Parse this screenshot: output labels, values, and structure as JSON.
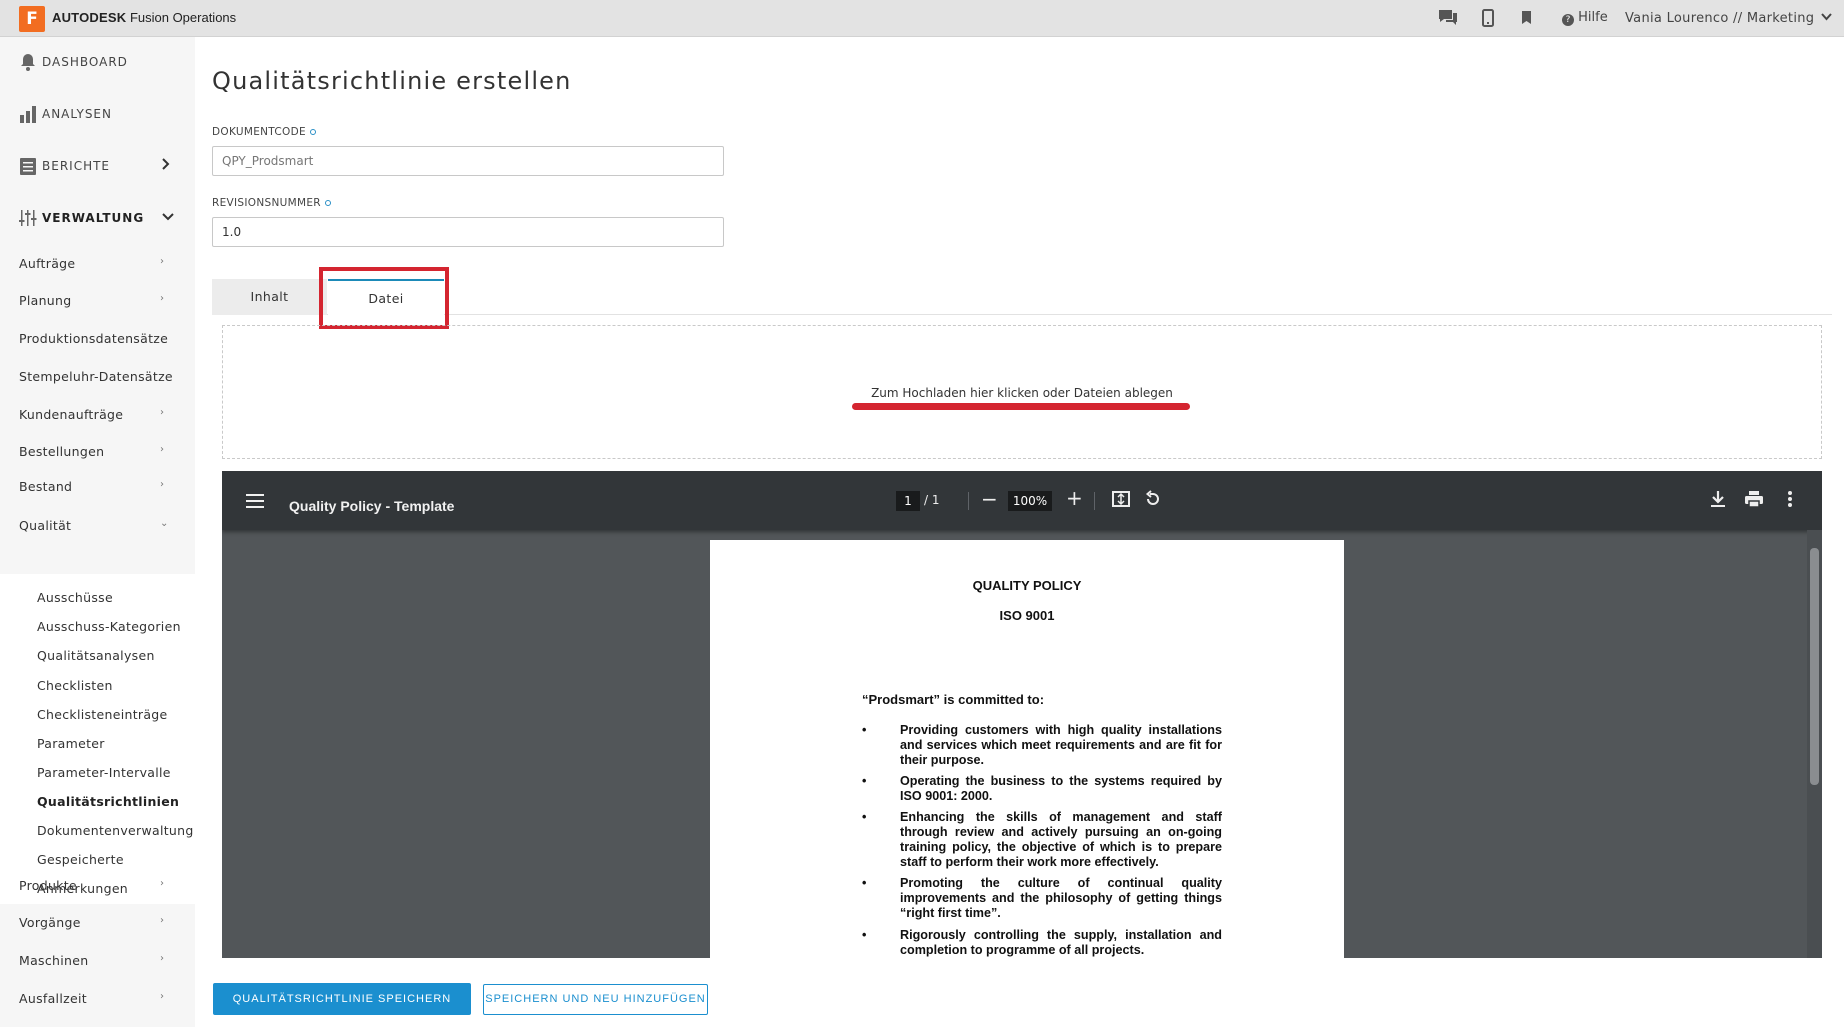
{
  "app": {
    "logo_letter": "F",
    "brand_bold": "AUTODESK",
    "brand_rest": "Fusion Operations",
    "brand_color": "#f26d21",
    "help_label": "Hilfe",
    "user_label": "Vania Lourenco // Marketing",
    "icons": [
      "chat-icon",
      "mobile-icon",
      "bookmark-icon",
      "question-icon",
      "chevron-down-icon"
    ]
  },
  "sidebar": {
    "main": [
      {
        "label": "DASHBOARD",
        "icon": "bell-icon"
      },
      {
        "label": "ANALYSEN",
        "icon": "bar-chart-icon"
      },
      {
        "label": "BERICHTE",
        "icon": "document-icon"
      },
      {
        "label": "VERWALTUNG",
        "icon": "sliders-icon"
      }
    ],
    "items": [
      {
        "label": "Aufträge"
      },
      {
        "label": "Planung"
      },
      {
        "label": "Produktionsdatensätze"
      },
      {
        "label": "Stempeluhr-Datensätze"
      },
      {
        "label": "Kundenaufträge"
      },
      {
        "label": "Bestellungen"
      },
      {
        "label": "Bestand"
      },
      {
        "label": "Qualität"
      }
    ],
    "quality_sub": [
      {
        "label": "Ausschüsse"
      },
      {
        "label": "Ausschuss-Kategorien"
      },
      {
        "label": "Qualitätsanalysen"
      },
      {
        "label": "Checklisten"
      },
      {
        "label": "Checklisteneinträge"
      },
      {
        "label": "Parameter"
      },
      {
        "label": "Parameter-Intervalle"
      },
      {
        "label": "Qualitätsrichtlinien"
      },
      {
        "label": "Dokumentenverwaltung"
      },
      {
        "label": "Gespeicherte"
      },
      {
        "label": "Anmerkungen"
      }
    ],
    "items_after": [
      {
        "label": "Produkte"
      },
      {
        "label": "Vorgänge"
      },
      {
        "label": "Maschinen"
      },
      {
        "label": "Ausfallzeit"
      }
    ]
  },
  "form": {
    "title": "Qualitätsrichtlinie erstellen",
    "doc_code_label": "DOKUMENTCODE",
    "doc_code_placeholder": "QPY_Prodsmart",
    "revision_label": "REVISIONSNUMMER",
    "revision_value": "1.0",
    "tabs": [
      {
        "label": "Inhalt"
      },
      {
        "label": "Datei"
      }
    ],
    "active_tab": "Datei",
    "dropzone_text": "Zum Hochladen hier klicken oder Dateien ablegen"
  },
  "viewer": {
    "title": "Quality Policy - Template",
    "page_current": "1",
    "page_total": "/ 1",
    "zoom": "100%",
    "zoom_out": "−",
    "zoom_in": "+"
  },
  "pdf": {
    "heading": "QUALITY POLICY",
    "subheading": "ISO 9001",
    "intro": "“Prodsmart” is committed to:",
    "bullet": "•",
    "bullets": [
      "Providing customers with high quality installations and services which meet requirements and are fit for their purpose.",
      "Operating the business to the systems required by ISO 9001: 2000.",
      "Enhancing the skills of management and staff through review and actively pursuing an on-going training policy, the objective of which is to prepare staff to perform their work more effectively.",
      "Promoting the culture of continual quality improvements and the philosophy of getting things “right first time”.",
      "Rigorously controlling the supply, installation and completion to programme of all projects."
    ]
  },
  "actions": {
    "save_label": "QUALITÄTSRICHTLINIE SPEICHERN",
    "save_new_label": "SPEICHERN UND NEU HINZUFÜGEN",
    "accent_color": "#1b8fcf"
  }
}
